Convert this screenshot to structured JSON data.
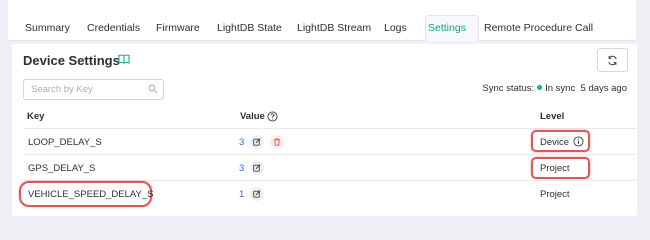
{
  "tabs": [
    {
      "label": "Summary"
    },
    {
      "label": "Credentials"
    },
    {
      "label": "Firmware"
    },
    {
      "label": "LightDB State"
    },
    {
      "label": "LightDB Stream"
    },
    {
      "label": "Logs"
    },
    {
      "label": "Settings"
    },
    {
      "label": "Remote Procedure Call"
    }
  ],
  "active_tab": "Settings",
  "page": {
    "title": "Device Settings",
    "search_placeholder": "Search by Key",
    "sync_label": "Sync status:",
    "sync_state": "In sync",
    "sync_time": "5 days ago"
  },
  "table": {
    "headers": {
      "key": "Key",
      "value": "Value",
      "level": "Level"
    },
    "rows": [
      {
        "key": "LOOP_DELAY_S",
        "value": "3",
        "level": "Device"
      },
      {
        "key": "GPS_DELAY_S",
        "value": "3",
        "level": "Project"
      },
      {
        "key": "VEHICLE_SPEED_DELAY_S",
        "value": "1",
        "level": "Project"
      }
    ]
  },
  "colors": {
    "accent": "#15a38a",
    "value_link": "#2b72d9",
    "sync_dot": "#1fb36b",
    "highlight": "#d85a5a",
    "delete": "#d9534f"
  },
  "icons": [
    "book-icon",
    "refresh-icon",
    "search-icon",
    "help-icon",
    "edit-icon",
    "delete-icon",
    "info-icon"
  ]
}
